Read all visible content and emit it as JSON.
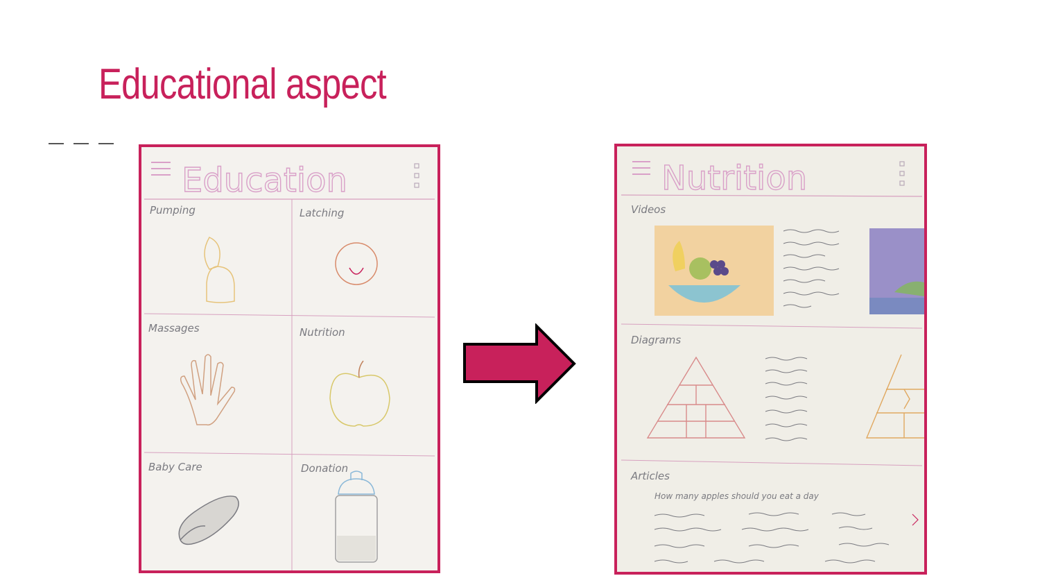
{
  "slide": {
    "title": "Educational aspect"
  },
  "left_sketch": {
    "header": "Education",
    "tiles": [
      "Pumping",
      "Latching",
      "Massages",
      "Nutrition",
      "Baby Care",
      "Donation"
    ]
  },
  "right_sketch": {
    "header": "Nutrition",
    "sections": [
      "Videos",
      "Diagrams",
      "Articles"
    ],
    "article_text": "How many apples should you eat a day"
  },
  "colors": {
    "accent": "#c8215b",
    "arrow_fill": "#c8215b",
    "paper": "#f4f2ee"
  },
  "icons": [
    "menu-icon",
    "more-vertical-icon",
    "arrow-right-icon"
  ]
}
